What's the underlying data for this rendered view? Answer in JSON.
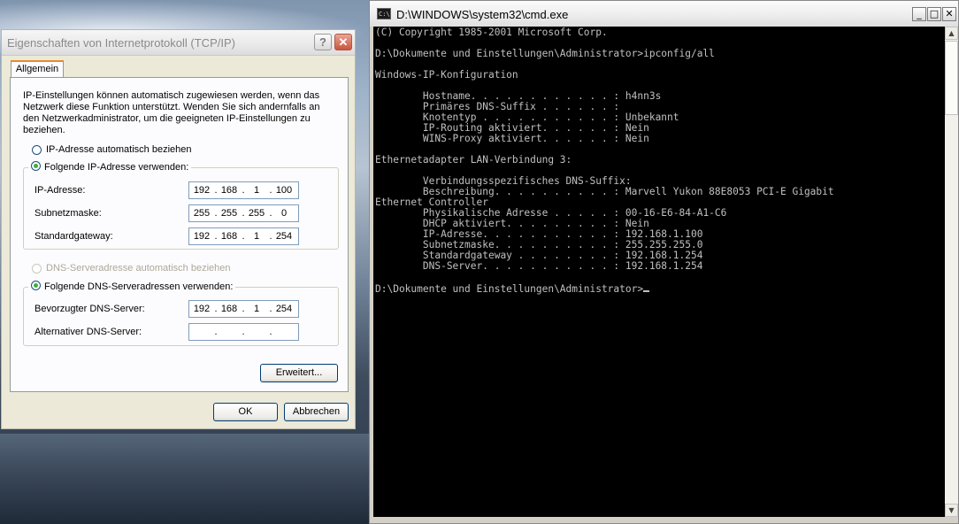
{
  "dialog": {
    "title": "Eigenschaften von Internetprotokoll (TCP/IP)",
    "help_label": "?",
    "close_label": "✕",
    "tab_label": "Allgemein",
    "intro_text": "IP-Einstellungen können automatisch zugewiesen werden, wenn das Netzwerk diese Funktion unterstützt. Wenden Sie sich andernfalls an den Netzwerkadministrator, um die geeigneten IP-Einstellungen zu beziehen.",
    "radio_ip_auto": "IP-Adresse automatisch beziehen",
    "radio_ip_manual": "Folgende IP-Adresse verwenden:",
    "ip_label": "IP-Adresse:",
    "ip_value": [
      "192",
      "168",
      "1",
      "100"
    ],
    "subnet_label": "Subnetzmaske:",
    "subnet_value": [
      "255",
      "255",
      "255",
      "0"
    ],
    "gateway_label": "Standardgateway:",
    "gateway_value": [
      "192",
      "168",
      "1",
      "254"
    ],
    "radio_dns_auto": "DNS-Serveradresse automatisch beziehen",
    "radio_dns_manual": "Folgende DNS-Serveradressen verwenden:",
    "preferred_dns_label": "Bevorzugter DNS-Server:",
    "preferred_dns_value": [
      "192",
      "168",
      "1",
      "254"
    ],
    "alternate_dns_label": "Alternativer DNS-Server:",
    "alternate_dns_value": [
      "",
      "",
      "",
      ""
    ],
    "advanced_button": "Erweitert...",
    "ok_button": "OK",
    "cancel_button": "Abbrechen"
  },
  "cmd": {
    "title": "D:\\WINDOWS\\system32\\cmd.exe",
    "icon_text": "C:\\",
    "minimize_label": "_",
    "maximize_label": "□",
    "close_label": "✕",
    "lines": [
      "(C) Copyright 1985-2001 Microsoft Corp.",
      "",
      "D:\\Dokumente und Einstellungen\\Administrator>ipconfig/all",
      "",
      "Windows-IP-Konfiguration",
      "",
      "        Hostname. . . . . . . . . . . . : h4nn3s",
      "        Primäres DNS-Suffix . . . . . . :",
      "        Knotentyp . . . . . . . . . . . : Unbekannt",
      "        IP-Routing aktiviert. . . . . . : Nein",
      "        WINS-Proxy aktiviert. . . . . . : Nein",
      "",
      "Ethernetadapter LAN-Verbindung 3:",
      "",
      "        Verbindungsspezifisches DNS-Suffix:",
      "        Beschreibung. . . . . . . . . . : Marvell Yukon 88E8053 PCI-E Gigabit",
      "Ethernet Controller",
      "        Physikalische Adresse . . . . . : 00-16-E6-84-A1-C6",
      "        DHCP aktiviert. . . . . . . . . : Nein",
      "        IP-Adresse. . . . . . . . . . . : 192.168.1.100",
      "        Subnetzmaske. . . . . . . . . . : 255.255.255.0",
      "        Standardgateway . . . . . . . . : 192.168.1.254",
      "        DNS-Server. . . . . . . . . . . : 192.168.1.254",
      "",
      "D:\\Dokumente und Einstellungen\\Administrator>"
    ]
  }
}
